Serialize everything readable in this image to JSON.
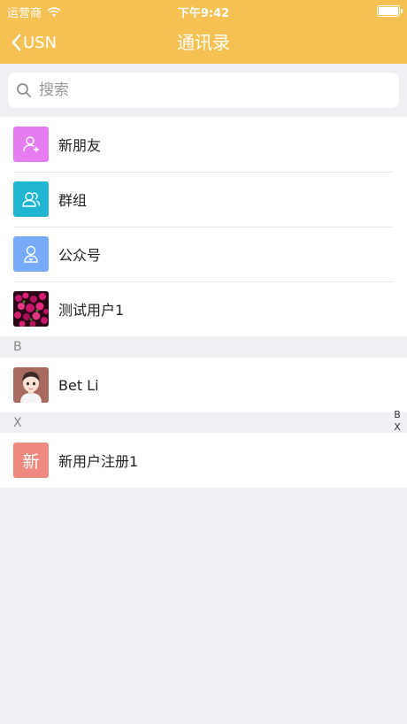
{
  "status_bar": {
    "carrier": "运营商",
    "time": "下午9:42",
    "wifi_icon": "wifi-icon",
    "battery_icon": "battery-icon"
  },
  "nav": {
    "back_label": "USN",
    "back_icon": "chevron-left-icon",
    "title": "通讯录"
  },
  "search": {
    "placeholder": "搜索",
    "icon": "search-icon"
  },
  "top_items": [
    {
      "label": "新朋友",
      "icon": "add-user-icon",
      "color": "#e57cf0"
    },
    {
      "label": "群组",
      "icon": "group-icon",
      "color": "#20b6d1"
    },
    {
      "label": "公众号",
      "icon": "official-account-icon",
      "color": "#77aaf8"
    },
    {
      "label": "测试用户1",
      "icon": "flower-photo-avatar",
      "color": "#8a1a4a"
    }
  ],
  "sections": [
    {
      "letter": "B",
      "contacts": [
        {
          "label": "Bet Li",
          "icon": "cartoon-girl-avatar"
        }
      ]
    },
    {
      "letter": "X",
      "contacts": [
        {
          "label": "新用户注册1",
          "avatar_text": "新",
          "color": "#ef8a80"
        }
      ]
    }
  ],
  "index_letters": [
    "B",
    "X"
  ],
  "colors": {
    "brand": "#f4c152",
    "background": "#efeff4"
  }
}
